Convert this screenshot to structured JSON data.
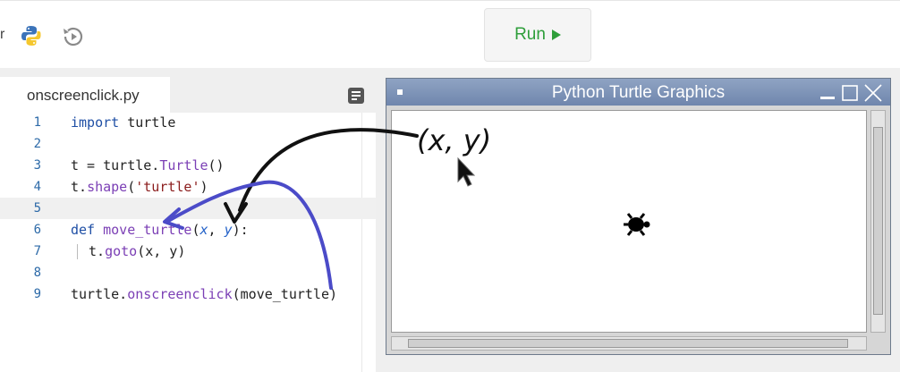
{
  "toolbar": {
    "cut_text": "r",
    "python_icon": "python-logo-icon",
    "history_icon": "history-icon",
    "run_label": "Run"
  },
  "editor": {
    "filename": "onscreenclick.py",
    "menu_icon": "menu-icon",
    "lines": [
      {
        "num": "1",
        "code": "import turtle"
      },
      {
        "num": "2",
        "code": ""
      },
      {
        "num": "3",
        "code": "t = turtle.Turtle()"
      },
      {
        "num": "4",
        "code": "t.shape('turtle')"
      },
      {
        "num": "5",
        "code": ""
      },
      {
        "num": "6",
        "code": "def move_turtle(x, y):"
      },
      {
        "num": "7",
        "code": "t.goto(x, y)"
      },
      {
        "num": "8",
        "code": ""
      },
      {
        "num": "9",
        "code": "turtle.onscreenclick(move_turtle)"
      }
    ],
    "active_line": "5"
  },
  "turtle_window": {
    "title": "Python Turtle Graphics",
    "annotation": "(x, y)"
  },
  "colors": {
    "run_green": "#2e9e3a",
    "keyword": "#1f4fa5",
    "function": "#7b3fb5",
    "string": "#8b1c1c",
    "annotation_black_arrow": "#111111",
    "annotation_blue_arrow": "#4b4bc8"
  }
}
